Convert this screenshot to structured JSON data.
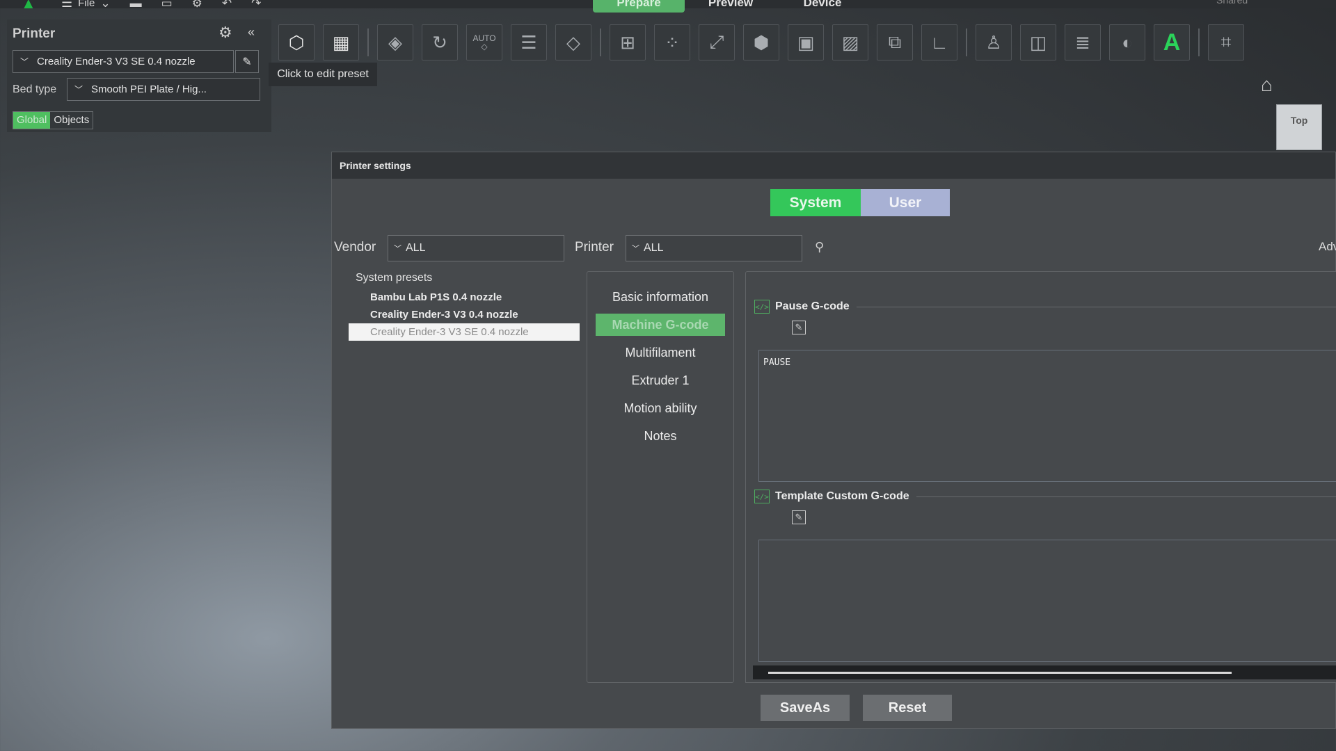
{
  "top": {
    "file_label": "File",
    "tabs": [
      "Prepare",
      "Preview",
      "Device"
    ],
    "right_label": "Shared"
  },
  "printer_panel": {
    "title": "Printer",
    "preset": "Creality Ender-3 V3 SE 0.4 nozzle",
    "bed_type_label": "Bed type",
    "bed_type": "Smooth PEI Plate / Hig...",
    "scope_global": "Global",
    "scope_objects": "Objects"
  },
  "toolbar": {
    "tooltip": "Click to edit preset",
    "auto_label": "AUTO",
    "text_tool_label": "A"
  },
  "view_cube": {
    "label": "Top"
  },
  "dialog": {
    "title": "Printer settings",
    "system_label": "System",
    "user_label": "User",
    "vendor_label": "Vendor",
    "vendor_value": "ALL",
    "printer_label": "Printer",
    "printer_value": "ALL",
    "advanced_label": "Adv",
    "preset_group": "System presets",
    "presets": [
      "Bambu Lab P1S 0.4 nozzle",
      "Creality Ender-3 V3 0.4 nozzle",
      "Creality Ender-3 V3 SE 0.4 nozzle"
    ],
    "nav": [
      "Basic information",
      "Machine G-code",
      "Multifilament",
      "Extruder 1",
      "Motion ability",
      "Notes"
    ],
    "pause_title": "Pause G-code",
    "pause_code": "PAUSE",
    "template_title": "Template Custom G-code",
    "template_code": "",
    "saveas_label": "SaveAs",
    "reset_label": "Reset"
  },
  "colors": {
    "accent_green": "#34c75a",
    "user_toggle": "#a8b1d4",
    "dialog_bg": "#46494c"
  }
}
